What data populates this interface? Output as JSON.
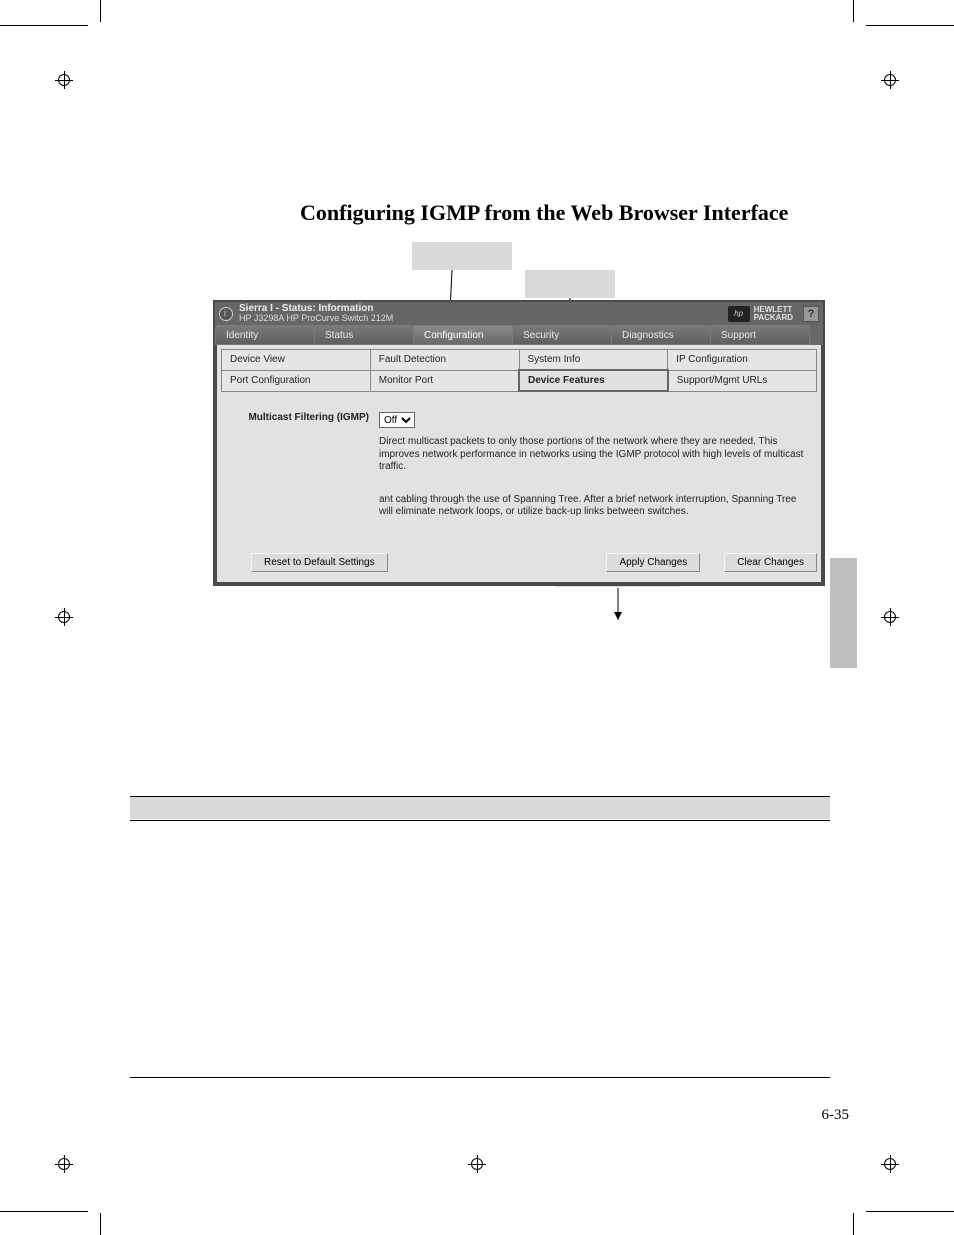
{
  "page_title": "Configuring IGMP from the Web Browser Interface",
  "page_number": "6-35",
  "window": {
    "title": "Sierra I - Status: Information",
    "subtitle": "HP J3298A HP ProCurve Switch 212M",
    "logo_text_line1": "HEWLETT",
    "logo_text_line2": "PACKARD",
    "help": "?"
  },
  "main_tabs": {
    "identity": "Identity",
    "status": "Status",
    "configuration": "Configuration",
    "security": "Security",
    "diagnostics": "Diagnostics",
    "support": "Support"
  },
  "sub_tabs": {
    "device_view": "Device View",
    "fault_detection": "Fault Detection",
    "system_info": "System Info",
    "ip_configuration": "IP Configuration",
    "port_configuration": "Port Configuration",
    "monitor_port": "Monitor Port",
    "device_features": "Device Features",
    "support_urls": "Support/Mgmt URLs"
  },
  "features": {
    "igmp_label": "Multicast Filtering (IGMP)",
    "igmp_value": "Off",
    "igmp_desc": "Direct multicast packets to only those portions of the network where they are needed. This improves network performance in networks using the IGMP protocol with high levels of multicast traffic.",
    "stp_desc": "ant cabling through the use of Spanning Tree. After a brief network interruption, Spanning Tree will eliminate network loops, or utilize back-up links between switches."
  },
  "buttons": {
    "reset": "Reset to Default Settings",
    "apply": "Apply Changes",
    "clear": "Clear Changes"
  }
}
